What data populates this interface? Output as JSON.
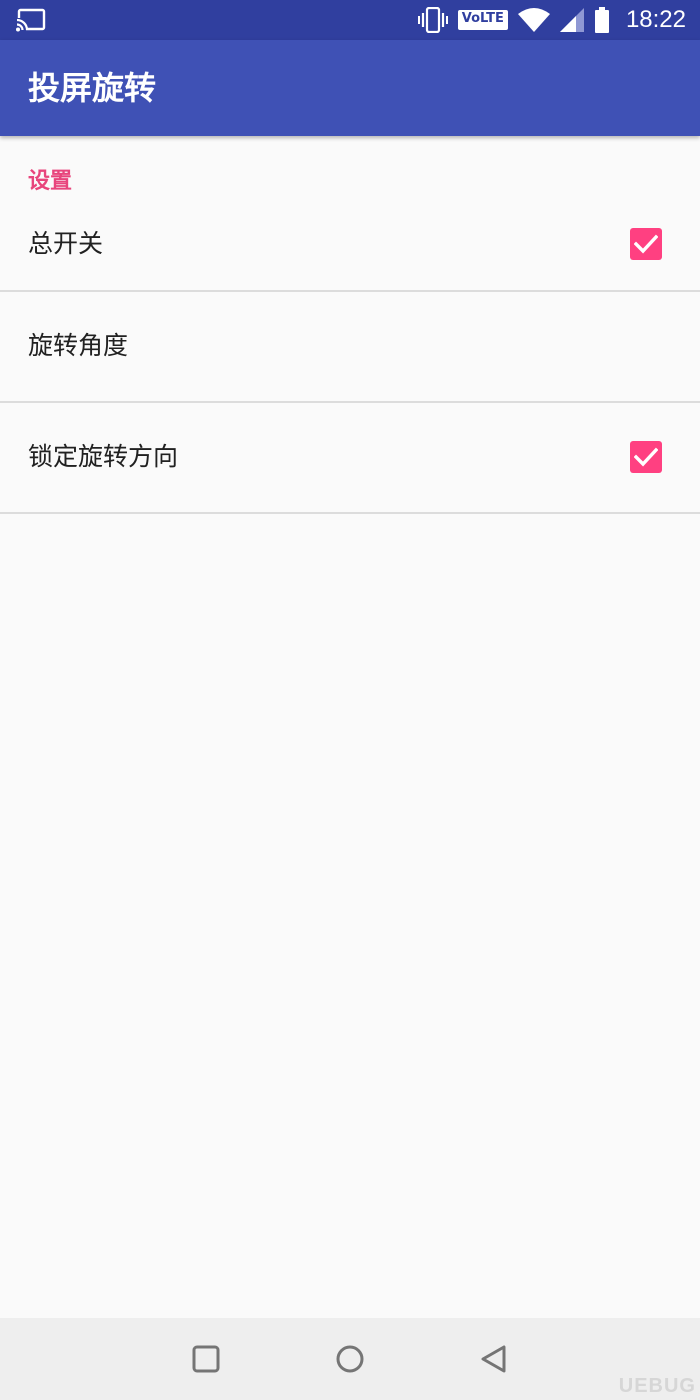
{
  "status_bar": {
    "icons": [
      "cast-icon",
      "vibrate-icon",
      "wifi-icon",
      "signal-icon",
      "battery-icon"
    ],
    "volte": "VoLTE",
    "time": "18:22"
  },
  "app_bar": {
    "title": "投屏旋转",
    "color": "#3f51b5"
  },
  "settings": {
    "category": "设置",
    "items": [
      {
        "label": "总开关",
        "checked": true
      },
      {
        "label": "旋转角度"
      },
      {
        "label": "锁定旋转方向",
        "checked": true
      }
    ],
    "accent": "#ff4081"
  },
  "nav_bar": {
    "icons": [
      "recents-icon",
      "home-icon",
      "back-icon"
    ]
  },
  "watermark": "UEBUG"
}
